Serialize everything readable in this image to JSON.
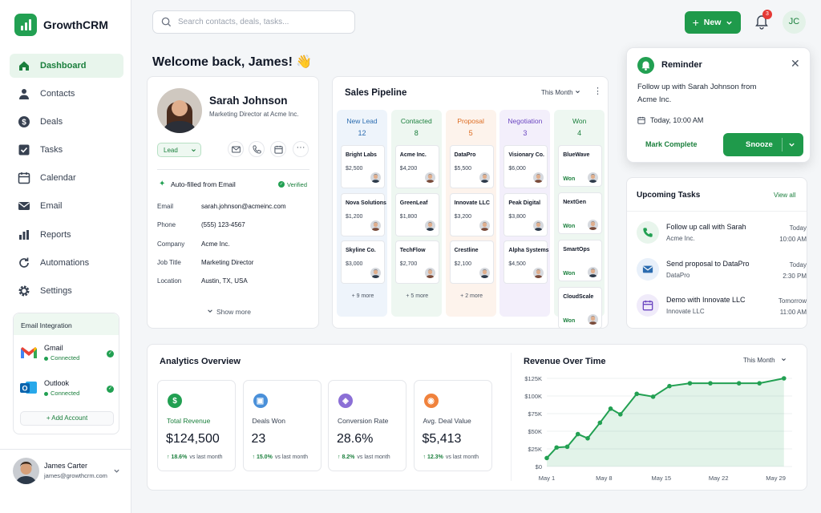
{
  "app": {
    "name": "GrowthCRM",
    "accent": "#1f9a4b"
  },
  "sidebar": {
    "items": [
      {
        "label": "Dashboard",
        "icon": "home-icon",
        "active": true
      },
      {
        "label": "Contacts",
        "icon": "user-icon"
      },
      {
        "label": "Deals",
        "icon": "dollar-icon"
      },
      {
        "label": "Tasks",
        "icon": "checkbox-icon"
      },
      {
        "label": "Calendar",
        "icon": "calendar-icon"
      },
      {
        "label": "Email",
        "icon": "mail-icon"
      },
      {
        "label": "Reports",
        "icon": "bar-chart-icon"
      },
      {
        "label": "Automations",
        "icon": "refresh-icon"
      },
      {
        "label": "Settings",
        "icon": "gear-icon"
      }
    ],
    "integration": {
      "title": "Email Integration",
      "accounts": [
        {
          "name": "Gmail",
          "status": "Connected"
        },
        {
          "name": "Outlook",
          "status": "Connected"
        }
      ],
      "add_label": "+ Add Account"
    },
    "user": {
      "name": "James Carter",
      "email": "james@growthcrm.com"
    }
  },
  "topbar": {
    "search_placeholder": "Search contacts, deals, tasks...",
    "new_label": "New",
    "notif_count": "3",
    "user_initials": "JC"
  },
  "welcome": "Welcome back, James! 👋",
  "contact": {
    "name": "Sarah Johnson",
    "title": "Marketing Director at Acme Inc.",
    "tag": "Lead",
    "autofill_label": "Auto-filled from Email",
    "verified": "Verified",
    "fields": [
      {
        "label": "Email",
        "value": "sarah.johnson@acmeinc.com"
      },
      {
        "label": "Phone",
        "value": "(555) 123-4567"
      },
      {
        "label": "Company",
        "value": "Acme Inc."
      },
      {
        "label": "Job Title",
        "value": "Marketing Director"
      },
      {
        "label": "Location",
        "value": "Austin, TX, USA"
      }
    ],
    "show_more": "Show more"
  },
  "pipeline": {
    "title": "Sales Pipeline",
    "period": "This Month",
    "columns": [
      {
        "name": "New Lead",
        "count": "12",
        "color": "#2b6cb0",
        "bg": "#eef4fb",
        "deals": [
          {
            "name": "Bright Labs",
            "value": "$2,500"
          },
          {
            "name": "Nova Solutions",
            "value": "$1,200"
          },
          {
            "name": "Skyline Co.",
            "value": "$3,000"
          }
        ],
        "more": "+ 9 more"
      },
      {
        "name": "Contacted",
        "count": "8",
        "color": "#1a7f3c",
        "bg": "#eef7f1",
        "deals": [
          {
            "name": "Acme Inc.",
            "value": "$4,200"
          },
          {
            "name": "GreenLeaf",
            "value": "$1,800"
          },
          {
            "name": "TechFlow",
            "value": "$2,700"
          }
        ],
        "more": "+ 5 more"
      },
      {
        "name": "Proposal",
        "count": "5",
        "color": "#dd6b20",
        "bg": "#fdf3ec",
        "deals": [
          {
            "name": "DataPro",
            "value": "$5,500"
          },
          {
            "name": "Innovate LLC",
            "value": "$3,200"
          },
          {
            "name": "Crestline",
            "value": "$2,100"
          }
        ],
        "more": "+ 2 more"
      },
      {
        "name": "Negotiation",
        "count": "3",
        "color": "#6b46c1",
        "bg": "#f3effb",
        "deals": [
          {
            "name": "Visionary Co.",
            "value": "$6,000"
          },
          {
            "name": "Peak Digital",
            "value": "$3,800"
          },
          {
            "name": "Alpha Systems",
            "value": "$4,500"
          }
        ],
        "more": ""
      },
      {
        "name": "Won",
        "count": "4",
        "color": "#1a7f3c",
        "bg": "#eef7f1",
        "deals": [
          {
            "name": "BlueWave",
            "value": "Won"
          },
          {
            "name": "NextGen",
            "value": "Won"
          },
          {
            "name": "SmartOps",
            "value": "Won"
          },
          {
            "name": "CloudScale",
            "value": "Won"
          }
        ],
        "more": ""
      }
    ]
  },
  "reminder": {
    "title": "Reminder",
    "text": "Follow up with Sarah Johnson from Acme Inc.",
    "time": "Today, 10:00 AM",
    "complete_label": "Mark Complete",
    "snooze_label": "Snooze"
  },
  "tasks": {
    "title": "Upcoming Tasks",
    "view_all": "View all",
    "items": [
      {
        "title": "Follow up call with Sarah",
        "sub": "Acme Inc.",
        "day": "Today",
        "time": "10:00 AM",
        "color": "#22a052",
        "bg": "#e8f5ec",
        "icon": "phone-icon"
      },
      {
        "title": "Send proposal to DataPro",
        "sub": "DataPro",
        "day": "Today",
        "time": "2:30 PM",
        "color": "#2b6cb0",
        "bg": "#e8f0fa",
        "icon": "mail-icon"
      },
      {
        "title": "Demo with Innovate LLC",
        "sub": "Innovate LLC",
        "day": "Tomorrow",
        "time": "11:00 AM",
        "color": "#6b46c1",
        "bg": "#f0ebfa",
        "icon": "calendar-icon"
      }
    ]
  },
  "analytics": {
    "title": "Analytics Overview",
    "stats": [
      {
        "label": "Total Revenue",
        "value": "$124,500",
        "change": "18.6%",
        "suffix": "vs last month",
        "color": "#22a052",
        "glyph": "$"
      },
      {
        "label": "Deals Won",
        "value": "23",
        "change": "15.0%",
        "suffix": "vs last month",
        "color": "#4a90d9",
        "glyph": "▣"
      },
      {
        "label": "Conversion Rate",
        "value": "28.6%",
        "change": "8.2%",
        "suffix": "vs last month",
        "color": "#8b6fd6",
        "glyph": "◈"
      },
      {
        "label": "Avg. Deal Value",
        "value": "$5,413",
        "change": "12.3%",
        "suffix": "vs last month",
        "color": "#f0823c",
        "glyph": "◉"
      }
    ]
  },
  "revenue": {
    "title": "Revenue Over Time",
    "period": "This Month"
  },
  "chart_data": {
    "type": "area",
    "title": "Revenue Over Time",
    "x_ticks": [
      "May 1",
      "May 8",
      "May 15",
      "May 22",
      "May 29"
    ],
    "y_ticks": [
      "$0",
      "$25K",
      "$50K",
      "$75K",
      "$100K",
      "$125K"
    ],
    "ylim": [
      0,
      125000
    ],
    "xlim": [
      1,
      31
    ],
    "x": [
      1,
      2.2,
      3.5,
      4.8,
      6,
      7.5,
      8.8,
      10,
      12,
      14,
      16,
      18.5,
      21,
      24.5,
      27,
      30
    ],
    "values": [
      12000,
      27000,
      28000,
      46000,
      40000,
      62000,
      82000,
      74000,
      103000,
      99000,
      114000,
      118000,
      118000,
      118000,
      118000,
      125000
    ],
    "grid": true,
    "color": "#22a052"
  }
}
